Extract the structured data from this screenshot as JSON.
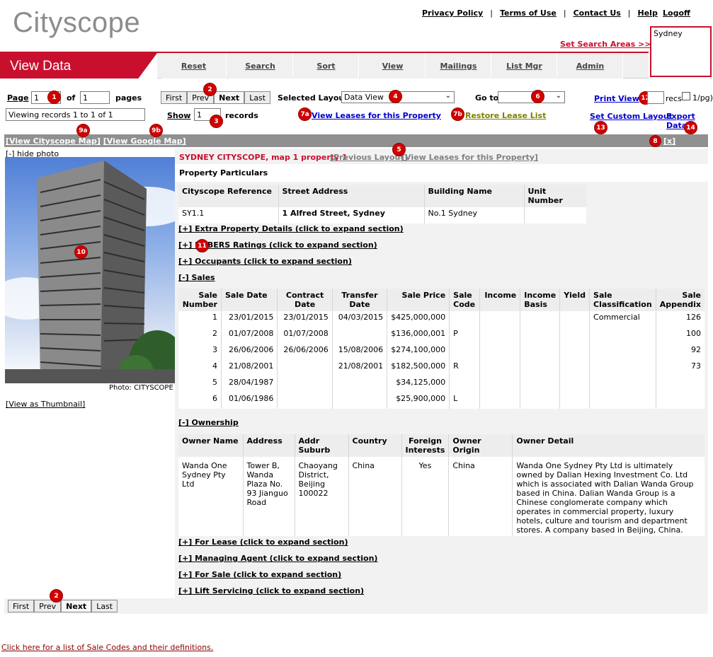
{
  "app": {
    "logo": "Cityscope",
    "page_title": "View Data"
  },
  "top_links": {
    "privacy": "Privacy Policy",
    "terms": "Terms of Use",
    "contact": "Contact Us",
    "help": "Help",
    "logoff": "Logoff",
    "sep": "|"
  },
  "search_area": {
    "link": "Set Search Areas >>",
    "value": "Sydney"
  },
  "nav": [
    "Reset",
    "Search",
    "Sort",
    "View",
    "Mailings",
    "List Mgr",
    "Admin"
  ],
  "pager": {
    "page_label": "Page",
    "page_value": "1",
    "of_label": "of",
    "total_pages": "1",
    "pages_label": "pages",
    "viewing": "Viewing records 1 to 1 of 1",
    "show_label": "Show",
    "show_value": "1",
    "records_label": "records",
    "buttons": [
      "First",
      "Prev",
      "Next",
      "Last"
    ]
  },
  "layout": {
    "selected_label": "Selected Layout:",
    "selected_value": "Data View",
    "goto_label": "Go to:",
    "print_view": "Print View",
    "recs_label": "recs",
    "per_pg_label": "1/pg)",
    "view_leases": "View Leases for this Property",
    "restore_lease": "Restore Lease List",
    "custom_layout": "Set Custom Layout",
    "export": "Export Data"
  },
  "markers": {
    "m1": "1",
    "m2": "2",
    "m3": "3",
    "m4": "4",
    "m5": "5",
    "m6": "6",
    "m7a": "7a",
    "m7b": "7b",
    "m8": "8",
    "m9a": "9a",
    "m9b": "9b",
    "m10": "10",
    "m11": "11",
    "m12": "12",
    "m13": "13",
    "m14": "14"
  },
  "map_links": {
    "cityscope": "[View Cityscope Map]",
    "google": "[View Google Map]",
    "remove": "[x] Remove"
  },
  "photo": {
    "hide": "[-] hide photo",
    "credit": "Photo: CITYSCOPE",
    "thumb": "[View as Thumbnail]"
  },
  "property": {
    "heading": "SYDNEY CITYSCOPE, map 1 property 1",
    "prev_layout": "[Previous Layout]",
    "view_leases": "[View Leases for this Property]",
    "particulars_label": "Property Particulars",
    "particulars_headers": [
      "Cityscope Reference",
      "Street Address",
      "Building Name",
      "Unit Number"
    ],
    "particulars_row": [
      "SY1.1",
      "1 Alfred Street, Sydney",
      "No.1 Sydney",
      ""
    ]
  },
  "sections": {
    "extra": "[+] Extra Property Details (click to expand section)",
    "nabers": "[+] NABERS Ratings (click to expand section)",
    "occupants": "[+] Occupants (click to expand section)",
    "sales": "[-] Sales",
    "ownership": "[-] Ownership",
    "for_lease": "[+] For Lease (click to expand section)",
    "managing_agent": "[+] Managing Agent (click to expand section)",
    "for_sale": "[+] For Sale (click to expand section)",
    "lift": "[+] Lift Servicing (click to expand section)"
  },
  "sales": {
    "headers": [
      "Sale Number",
      "Sale Date",
      "Contract Date",
      "Transfer Date",
      "Sale Price",
      "Sale Code",
      "Income",
      "Income Basis",
      "Yield",
      "Sale Classification",
      "Sale Appendix"
    ],
    "rows": [
      [
        "1",
        "23/01/2015",
        "23/01/2015",
        "04/03/2015",
        "$425,000,000",
        "",
        "",
        "",
        "",
        "Commercial",
        "126"
      ],
      [
        "2",
        "01/07/2008",
        "01/07/2008",
        "",
        "$136,000,001",
        "P",
        "",
        "",
        "",
        "",
        "100"
      ],
      [
        "3",
        "26/06/2006",
        "26/06/2006",
        "15/08/2006",
        "$274,100,000",
        "",
        "",
        "",
        "",
        "",
        "92"
      ],
      [
        "4",
        "21/08/2001",
        "",
        "21/08/2001",
        "$182,500,000",
        "R",
        "",
        "",
        "",
        "",
        "73"
      ],
      [
        "5",
        "28/04/1987",
        "",
        "",
        "$34,125,000",
        "",
        "",
        "",
        "",
        "",
        ""
      ],
      [
        "6",
        "01/06/1986",
        "",
        "",
        "$25,900,000",
        "L",
        "",
        "",
        "",
        "",
        ""
      ]
    ]
  },
  "ownership": {
    "headers": [
      "Owner Name",
      "Address",
      "Addr Suburb",
      "Country",
      "Foreign Interests",
      "Owner Origin",
      "Owner Detail"
    ],
    "row": [
      "Wanda One Sydney Pty Ltd",
      "Tower B, Wanda Plaza No. 93 Jianguo Road",
      "Chaoyang District, Beijing 100022",
      "China",
      "Yes",
      "China",
      "Wanda One Sydney Pty Ltd is ultimately owned by Dalian Hexing Investment Co. Ltd which is associated with Dalian Wanda Group based in China. Dalian Wanda Group is a Chinese conglomerate company which operates in commercial property, luxury hotels, culture and tourism and department stores. A company based in Beijing, China."
    ]
  },
  "footer": {
    "sale_codes": "Click here for a list of Sale Codes and their definitions."
  },
  "colors": {
    "brand_red": "#c8102e",
    "link_blue": "#0000cc",
    "bar_gray": "#909090"
  }
}
